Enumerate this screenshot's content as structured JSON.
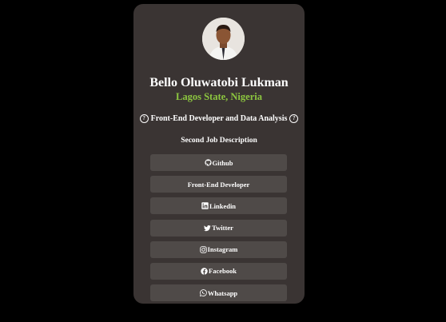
{
  "profile": {
    "name": "Bello Oluwatobi Lukman",
    "location": "Lagos State, Nigeria",
    "role": "Front-End Developer and Data Analysis",
    "second": "Second Job Description"
  },
  "colors": {
    "page_background": "#000000",
    "card_background": "#3a3433",
    "button_background": "#4f4a48",
    "location_text": "#8cc63f",
    "text": "#ffffff"
  },
  "links": [
    {
      "label": "Github",
      "icon": "github-icon"
    },
    {
      "label": "Front-End Developer",
      "icon": ""
    },
    {
      "label": "Linkedin",
      "icon": "linkedin-icon"
    },
    {
      "label": "Twitter",
      "icon": "twitter-icon"
    },
    {
      "label": "Instagram",
      "icon": "instagram-icon"
    },
    {
      "label": "Facebook",
      "icon": "facebook-icon"
    },
    {
      "label": " Whatsapp",
      "icon": "whatsapp-icon"
    }
  ]
}
